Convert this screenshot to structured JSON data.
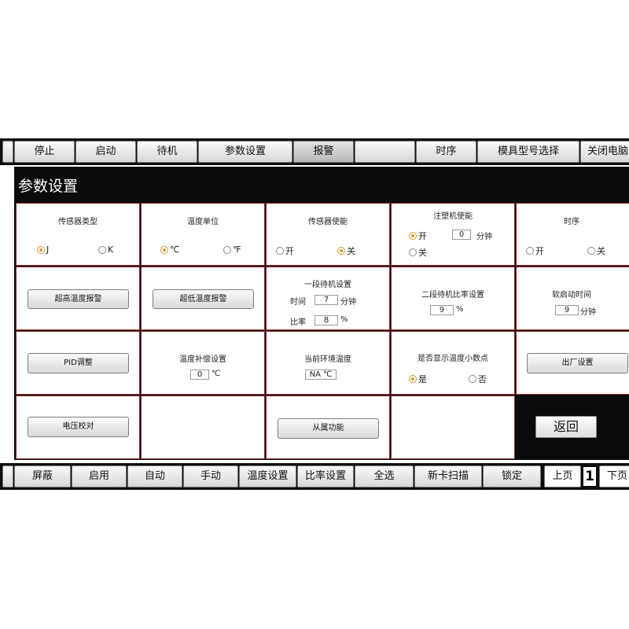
{
  "top_nav": [
    "停止",
    "启动",
    "待机",
    "参数设置",
    "报警",
    "",
    "时序",
    "模具型号选择",
    "关闭电脑"
  ],
  "title": "参数设置",
  "cells": {
    "sensor_type": {
      "label": "传感器类型",
      "opt1": "J",
      "opt2": "K",
      "selected": "J"
    },
    "temp_unit": {
      "label": "温度单位",
      "opt1": "℃",
      "opt2": "℉",
      "selected": "℃"
    },
    "sensor_enable": {
      "label": "传感器使能",
      "opt1": "开",
      "opt2": "关",
      "selected": "关"
    },
    "injection_enable": {
      "label": "注塑机使能",
      "opt1": "开",
      "opt2": "关",
      "selected": "开",
      "value": "0",
      "unit": "分钟"
    },
    "timing": {
      "label": "时序",
      "opt1": "开",
      "opt2": "关"
    },
    "over_temp": {
      "button": "超高温度报警"
    },
    "under_temp": {
      "button": "超低温度报警"
    },
    "standby1": {
      "label": "一段待机设置",
      "time_label": "时间",
      "time_value": "7",
      "time_unit": "分钟",
      "ratio_label": "比率",
      "ratio_value": "8",
      "ratio_unit": "%"
    },
    "standby2": {
      "label": "二段待机比率设置",
      "value": "9",
      "unit": "%"
    },
    "soft_start": {
      "label": "软启动时间",
      "value": "9",
      "unit": "分钟"
    },
    "pid": {
      "button": "PID调整"
    },
    "temp_comp": {
      "label": "温度补偿设置",
      "value": "0",
      "unit": "℃"
    },
    "ambient": {
      "label": "当前环境温度",
      "value": "NA",
      "unit": "℃"
    },
    "decimal": {
      "label": "是否显示温度小数点",
      "opt1": "是",
      "opt2": "否",
      "selected": "是"
    },
    "factory": {
      "button": "出厂设置"
    },
    "voltage": {
      "button": "电压校对"
    },
    "slave": {
      "button": "从属功能"
    }
  },
  "back_button": "返回",
  "bottom_nav": [
    "屏蔽",
    "启用",
    "自动",
    "手动",
    "温度设置",
    "比率设置",
    "全选",
    "新卡扫描",
    "锁定",
    "上页",
    "下页"
  ],
  "page_number": "1"
}
